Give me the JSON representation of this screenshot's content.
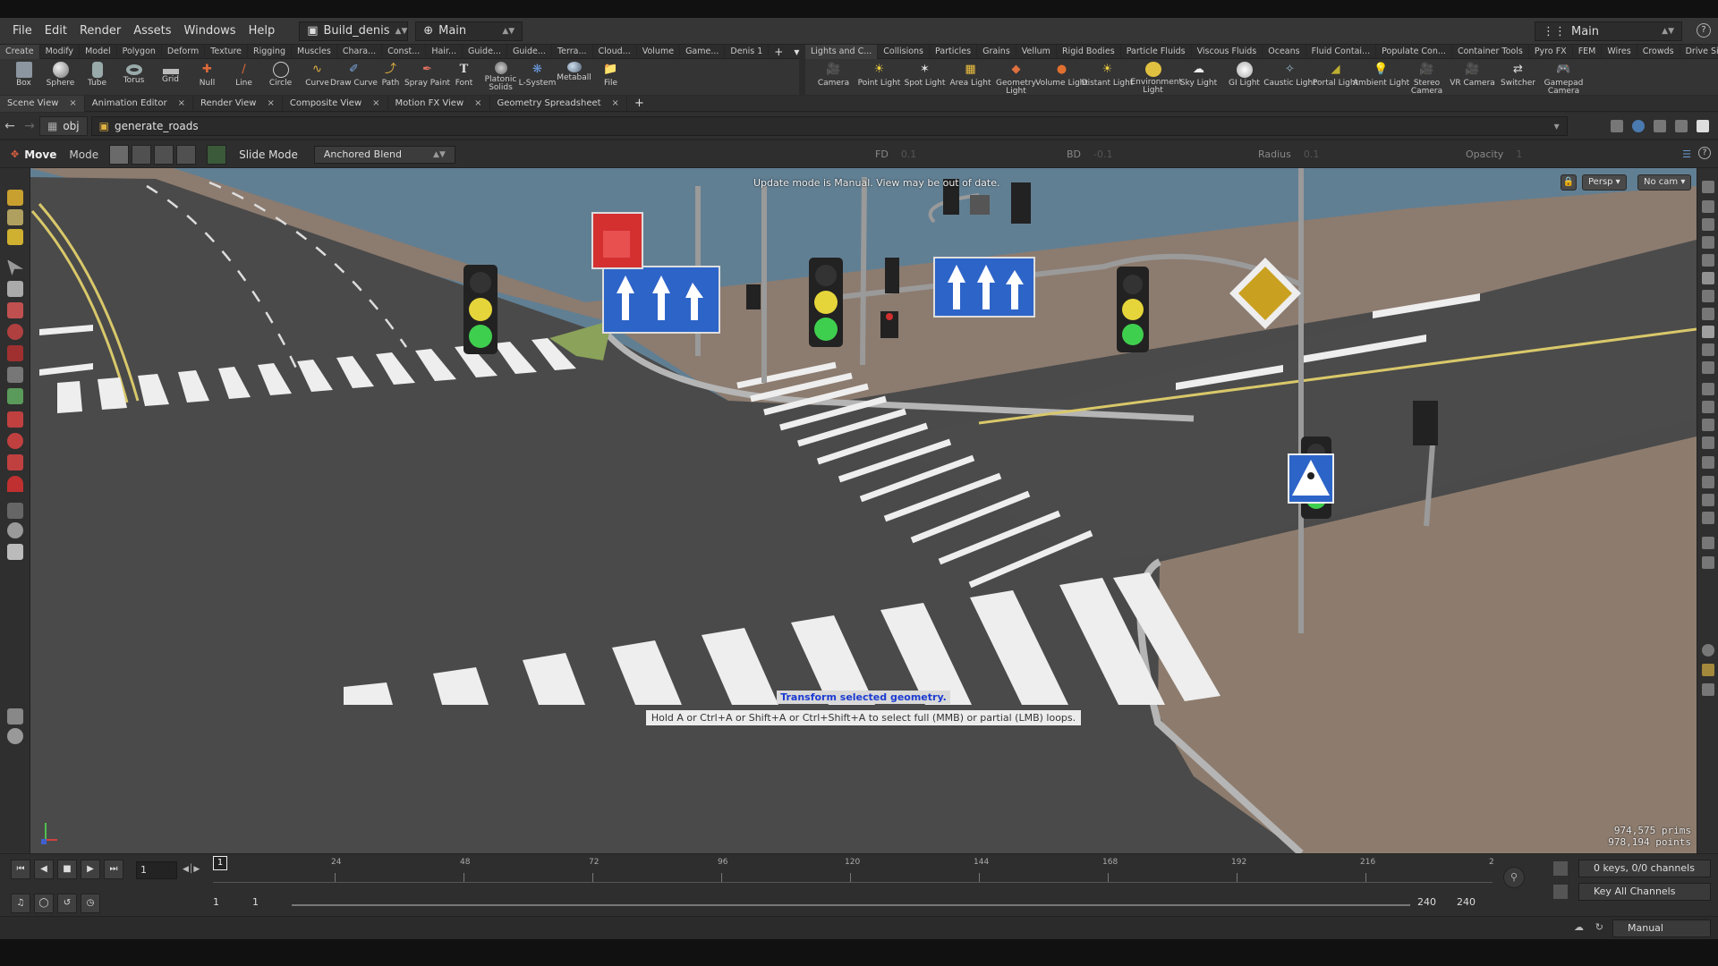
{
  "menu": {
    "items": [
      "File",
      "Edit",
      "Render",
      "Assets",
      "Windows",
      "Help"
    ],
    "desktop": "Build_denis",
    "network": "Main",
    "right_desktop": "Main"
  },
  "shelf_left": {
    "tabs": [
      "Create",
      "Modify",
      "Model",
      "Polygon",
      "Deform",
      "Texture",
      "Rigging",
      "Muscles",
      "Chara...",
      "Const...",
      "Hair...",
      "Guide...",
      "Guide...",
      "Terra...",
      "Cloud...",
      "Volume",
      "Game...",
      "Denis 1"
    ],
    "tools": [
      "Box",
      "Sphere",
      "Tube",
      "Torus",
      "Grid",
      "Null",
      "Line",
      "Circle",
      "Curve",
      "Draw Curve",
      "Path",
      "Spray Paint",
      "Font",
      "Platonic Solids",
      "L-System",
      "Metaball",
      "File"
    ]
  },
  "shelf_right": {
    "tabs": [
      "Lights and C...",
      "Collisions",
      "Particles",
      "Grains",
      "Vellum",
      "Rigid Bodies",
      "Particle Fluids",
      "Viscous Fluids",
      "Oceans",
      "Fluid Contai...",
      "Populate Con...",
      "Container Tools",
      "Pyro FX",
      "FEM",
      "Wires",
      "Crowds",
      "Drive Simula..."
    ],
    "tools": [
      "Camera",
      "Point Light",
      "Spot Light",
      "Area Light",
      "Geometry Light",
      "Volume Light",
      "Distant Light",
      "Environment Light",
      "Sky Light",
      "GI Light",
      "Caustic Light",
      "Portal Light",
      "Ambient Light",
      "Stereo Camera",
      "VR Camera",
      "Switcher",
      "Gamepad Camera"
    ]
  },
  "pane_tabs": [
    "Scene View",
    "Animation Editor",
    "Render View",
    "Composite View",
    "Motion FX View",
    "Geometry Spreadsheet"
  ],
  "path": {
    "root": "obj",
    "node": "generate_roads"
  },
  "opbar": {
    "tool": "Move",
    "mode": "Mode",
    "slide": "Slide Mode",
    "blend": "Anchored Blend",
    "fd_label": "FD",
    "fd_value": "0.1",
    "bd_label": "BD",
    "bd_value": "-0.1",
    "radius_label": "Radius",
    "radius_value": "0.1",
    "opacity_label": "Opacity",
    "opacity_value": "1"
  },
  "viewport": {
    "update_msg": "Update mode is Manual. View may be out of date.",
    "persp": "Persp ▾",
    "cam": "No cam ▾",
    "hint_title": "Transform selected geometry.",
    "hint_body": "Hold A or Ctrl+A or Shift+A or Ctrl+Shift+A to select full (MMB) or partial (LMB) loops.",
    "prims": "974,575  prims",
    "points": "978,194 points"
  },
  "timeline": {
    "frame": "1",
    "cursor": "1",
    "ticks": [
      "24",
      "48",
      "72",
      "96",
      "120",
      "144",
      "168",
      "192",
      "216",
      "2"
    ],
    "range_start": "1",
    "range_start2": "1",
    "range_end": "240",
    "range_end2": "240",
    "keys": "0 keys, 0/0 channels",
    "key_all": "Key All Channels",
    "update_mode": "Manual"
  }
}
